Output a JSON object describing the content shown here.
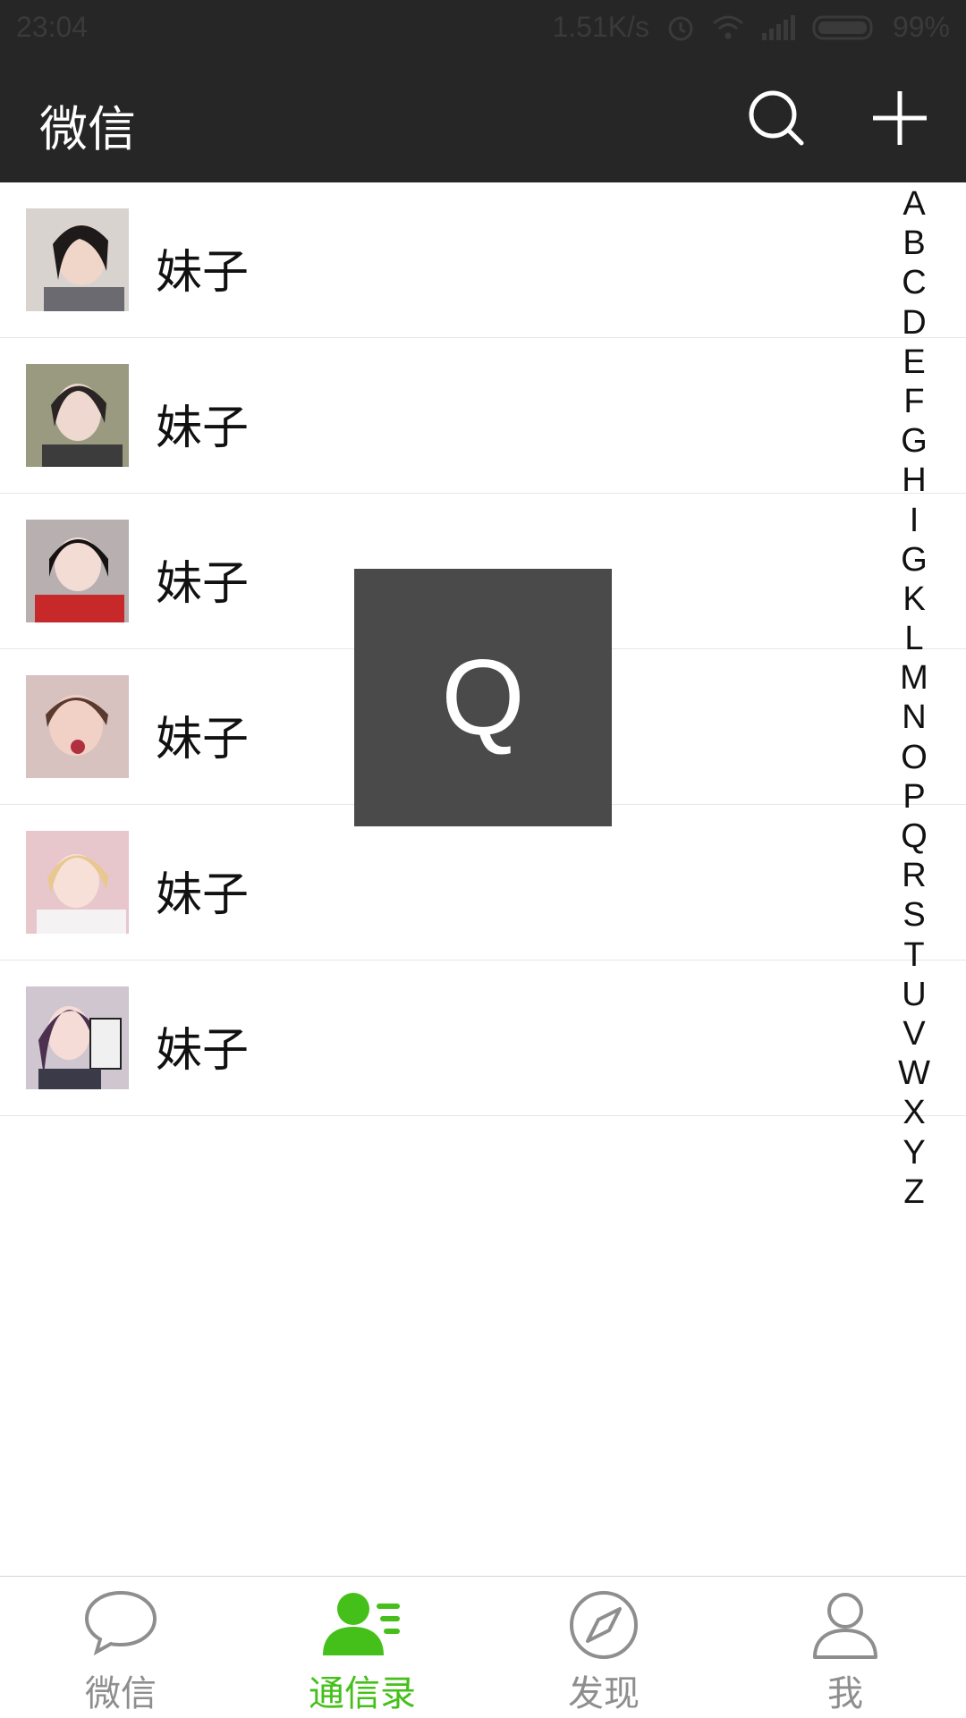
{
  "status_bar": {
    "time": "23:04",
    "net_speed": "1.51K/s",
    "battery": "99%"
  },
  "header": {
    "title": "微信"
  },
  "contacts": [
    {
      "name": "妹子"
    },
    {
      "name": "妹子"
    },
    {
      "name": "妹子"
    },
    {
      "name": "妹子"
    },
    {
      "name": "妹子"
    },
    {
      "name": "妹子"
    }
  ],
  "index_letters": [
    "A",
    "B",
    "C",
    "D",
    "E",
    "F",
    "G",
    "H",
    "I",
    "G",
    "K",
    "L",
    "M",
    "N",
    "O",
    "P",
    "Q",
    "R",
    "S",
    "T",
    "U",
    "V",
    "W",
    "X",
    "Y",
    "Z"
  ],
  "overlay_letter": "Q",
  "tabs": [
    {
      "label": "微信",
      "icon": "chat-bubble-icon",
      "active": false
    },
    {
      "label": "通信录",
      "icon": "contacts-icon",
      "active": true
    },
    {
      "label": "发现",
      "icon": "compass-icon",
      "active": false
    },
    {
      "label": "我",
      "icon": "person-icon",
      "active": false
    }
  ],
  "colors": {
    "header_bg": "#262626",
    "accent": "#45c01a",
    "inactive": "#8e8e8e",
    "overlay_bg": "#4a4a4a"
  }
}
